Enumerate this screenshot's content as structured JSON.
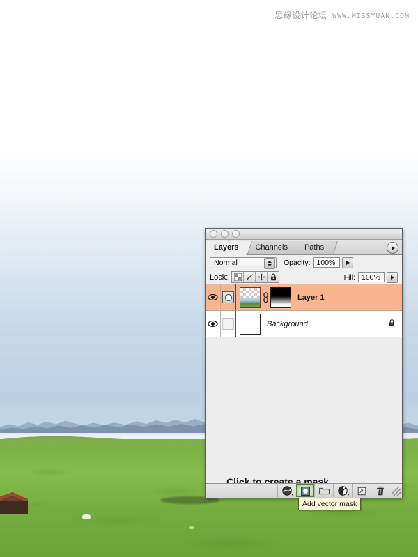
{
  "watermark": {
    "chinese": "思缘设计论坛",
    "url": "WWW.MISSYUAN.COM"
  },
  "palette": {
    "window_buttons": [
      "close",
      "minimize",
      "zoom"
    ],
    "tabs": [
      {
        "label": "Layers",
        "active": true
      },
      {
        "label": "Channels",
        "active": false
      },
      {
        "label": "Paths",
        "active": false
      }
    ],
    "menu_icon": "palette-menu-triangle-icon",
    "options": {
      "blend_mode": "Normal",
      "opacity_label": "Opacity:",
      "opacity_value": "100%",
      "fill_label": "Fill:",
      "fill_value": "100%"
    },
    "lock": {
      "label": "Lock:",
      "buttons": [
        {
          "name": "lock-transparent-pixels",
          "icon": "checkerboard-icon"
        },
        {
          "name": "lock-image-pixels",
          "icon": "brush-icon"
        },
        {
          "name": "lock-position",
          "icon": "move-cross-icon"
        },
        {
          "name": "lock-all",
          "icon": "padlock-icon"
        }
      ]
    },
    "layers": [
      {
        "name": "Layer 1",
        "visible": true,
        "selected": true,
        "italic": false,
        "has_mask_indicator": true,
        "has_link": true,
        "has_mask_thumb": true,
        "locked": false
      },
      {
        "name": "Background",
        "visible": true,
        "selected": false,
        "italic": true,
        "has_mask_indicator": false,
        "has_link": false,
        "has_mask_thumb": false,
        "locked": true
      }
    ],
    "annotation": {
      "text": "Click to create a mask",
      "arrow": "arrow-pointing-down-right"
    },
    "toolbar": [
      {
        "name": "layer-style-button",
        "icon": "fx-circle-icon",
        "has_dropdown": true,
        "hot": false
      },
      {
        "name": "add-layer-mask-button",
        "icon": "mask-circle-icon",
        "has_dropdown": false,
        "hot": true
      },
      {
        "name": "new-group-button",
        "icon": "folder-icon",
        "has_dropdown": false,
        "hot": false
      },
      {
        "name": "new-adjustment-layer-button",
        "icon": "half-circle-icon",
        "has_dropdown": true,
        "hot": false
      },
      {
        "name": "new-layer-button",
        "icon": "new-page-icon",
        "has_dropdown": false,
        "hot": false
      },
      {
        "name": "delete-layer-button",
        "icon": "trash-icon",
        "has_dropdown": false,
        "hot": false
      }
    ],
    "tooltip": "Add vector mask"
  },
  "colors": {
    "selected_layer_bg": "#f7b68f",
    "tooltip_bg": "#fdf6d8",
    "panel_bg": "#e9e9e9",
    "meadow_green": "#7db545",
    "sky_blue": "#c0d4e6"
  }
}
